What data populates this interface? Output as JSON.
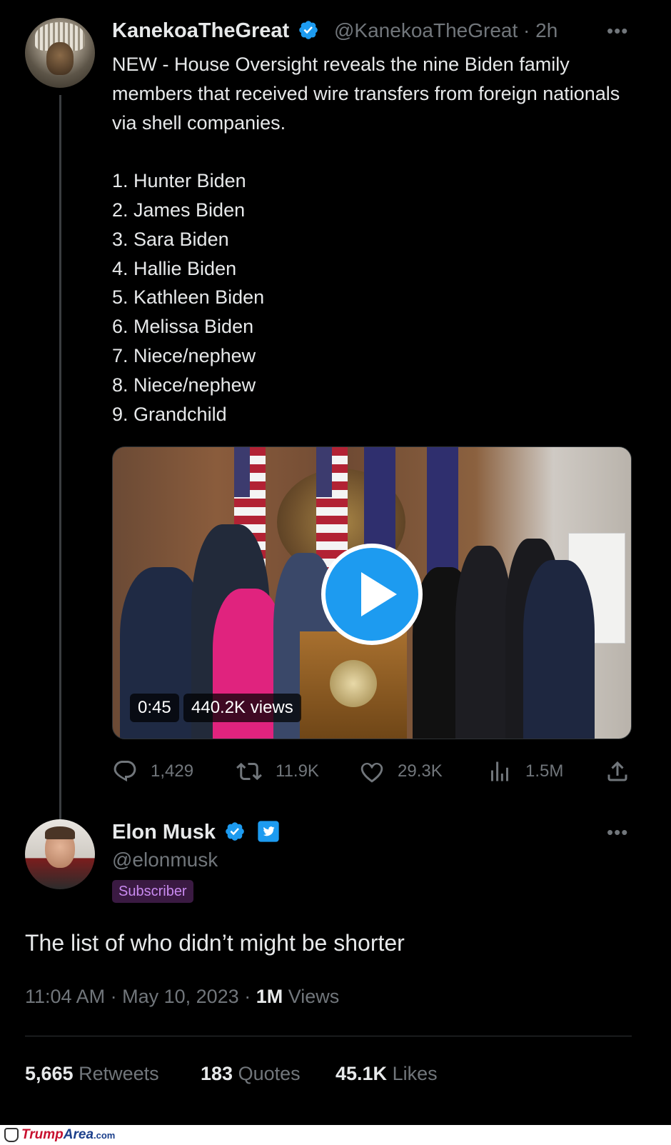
{
  "tweet": {
    "author_name": "KanekoaTheGreat",
    "author_handle": "@KanekoaTheGreat",
    "separator": "·",
    "time_ago": "2h",
    "text": "NEW - House Oversight reveals the nine Biden family members that received wire transfers from foreign nationals via shell companies.\n\n1. Hunter Biden\n2. James Biden\n3. Sara Biden\n4. Hallie Biden\n5. Kathleen Biden\n6. Melissa Biden\n7. Niece/nephew\n8. Niece/nephew\n9. Grandchild",
    "video": {
      "duration": "0:45",
      "views": "440.2K views"
    },
    "actions": {
      "replies": "1,429",
      "retweets": "11.9K",
      "likes": "29.3K",
      "views": "1.5M"
    }
  },
  "reply": {
    "author_name": "Elon Musk",
    "author_handle": "@elonmusk",
    "badge": "Subscriber",
    "text": "The list of who didn’t might be shorter",
    "time": "11:04 AM",
    "date": "May 10, 2023",
    "views_count": "1M",
    "views_label": "Views",
    "stats": {
      "retweets_count": "5,665",
      "retweets_label": "Retweets",
      "quotes_count": "183",
      "quotes_label": "Quotes",
      "likes_count": "45.1K",
      "likes_label": "Likes"
    }
  },
  "watermark": {
    "brand_a": "Trump",
    "brand_b": "Area",
    "suffix": ".com"
  },
  "colors": {
    "background": "#000000",
    "text": "#e7e9ea",
    "muted": "#71767b",
    "accent": "#1d9bf0",
    "subscriber": "#c98af0"
  },
  "icons": [
    "verified-badge-icon",
    "more-icon",
    "play-icon",
    "reply-icon",
    "retweet-icon",
    "like-icon",
    "views-icon",
    "share-icon",
    "twitter-bird-icon"
  ]
}
